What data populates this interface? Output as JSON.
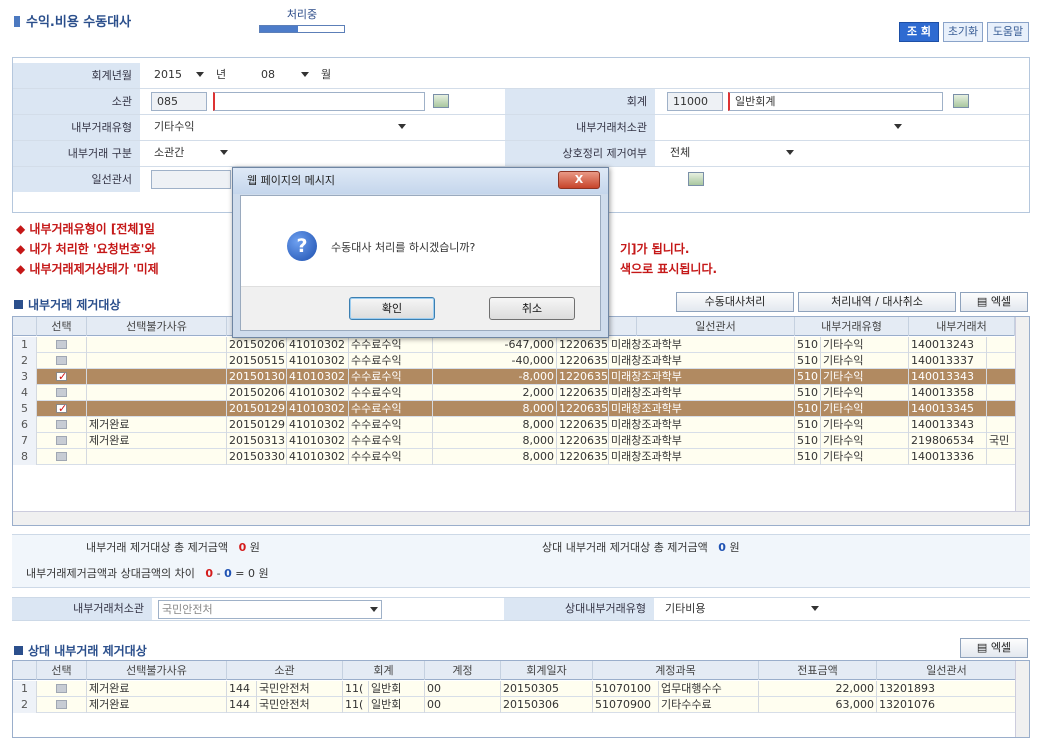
{
  "header": {
    "title": "수익.비용 수동대사",
    "processing": "처리중",
    "processing_progress": 0.45,
    "buttons": {
      "search": "조 회",
      "reset": "초기화",
      "help": "도움말"
    }
  },
  "form": {
    "account_year_label": "회계년월",
    "year": "2015",
    "year_unit": "년",
    "month": "08",
    "month_unit": "월",
    "office_label": "소관",
    "office_code": "085",
    "office_name": "",
    "accounting_label": "회계",
    "accounting_code": "11000",
    "accounting_name": "일반회계",
    "type_label": "내부거래유형",
    "type_value": "기타수익",
    "counter_office_label": "내부거래처소관",
    "counter_office_value": "",
    "category_label": "내부거래 구분",
    "category_value": "소관간",
    "cancel_label": "상호정리 제거여부",
    "cancel_value": "전체",
    "line_office_label": "일선관서"
  },
  "notes": [
    "◆ 내부거래유형이 [전체]일",
    "◆ 내가 처리한 '요청번호'와",
    "◆ 내부거래제거상태가 '미제"
  ],
  "notes_tail": [
    "",
    "기]가 됩니다.",
    "색으로 표시됩니다."
  ],
  "section1": {
    "title": "내부거래 제거대상",
    "btn_manual": "수동대사처리",
    "btn_history": "처리내역 / 대사취소",
    "btn_excel": "엑셀",
    "headers": [
      "선택",
      "선택불가사유",
      "",
      "",
      "",
      "",
      "일선관서",
      "내부거래유형",
      "내부거래처"
    ],
    "rows": [
      {
        "no": "1",
        "checked": false,
        "reason": "",
        "date": "20150206",
        "acct": "41010302",
        "item": "수수료수익",
        "amount": "-647,000",
        "office": "1220635",
        "office_name": "미래창조과학부",
        "type_code": "510",
        "type_name": "기타수익",
        "ref": "140013243",
        "extra": "",
        "selected": false
      },
      {
        "no": "2",
        "checked": false,
        "reason": "",
        "date": "20150515",
        "acct": "41010302",
        "item": "수수료수익",
        "amount": "-40,000",
        "office": "1220635",
        "office_name": "미래창조과학부",
        "type_code": "510",
        "type_name": "기타수익",
        "ref": "140013337",
        "extra": "",
        "selected": false
      },
      {
        "no": "3",
        "checked": true,
        "reason": "",
        "date": "20150130",
        "acct": "41010302",
        "item": "수수료수익",
        "amount": "-8,000",
        "office": "1220635",
        "office_name": "미래창조과학부",
        "type_code": "510",
        "type_name": "기타수익",
        "ref": "140013343",
        "extra": "",
        "selected": true
      },
      {
        "no": "4",
        "checked": false,
        "reason": "",
        "date": "20150206",
        "acct": "41010302",
        "item": "수수료수익",
        "amount": "2,000",
        "office": "1220635",
        "office_name": "미래창조과학부",
        "type_code": "510",
        "type_name": "기타수익",
        "ref": "140013358",
        "extra": "",
        "selected": false
      },
      {
        "no": "5",
        "checked": true,
        "reason": "",
        "date": "20150129",
        "acct": "41010302",
        "item": "수수료수익",
        "amount": "8,000",
        "office": "1220635",
        "office_name": "미래창조과학부",
        "type_code": "510",
        "type_name": "기타수익",
        "ref": "140013345",
        "extra": "",
        "selected": true
      },
      {
        "no": "6",
        "checked": false,
        "reason": "제거완료",
        "date": "20150129",
        "acct": "41010302",
        "item": "수수료수익",
        "amount": "8,000",
        "office": "1220635",
        "office_name": "미래창조과학부",
        "type_code": "510",
        "type_name": "기타수익",
        "ref": "140013343",
        "extra": "",
        "selected": false
      },
      {
        "no": "7",
        "checked": false,
        "reason": "제거완료",
        "date": "20150313",
        "acct": "41010302",
        "item": "수수료수익",
        "amount": "8,000",
        "office": "1220635",
        "office_name": "미래창조과학부",
        "type_code": "510",
        "type_name": "기타수익",
        "ref": "219806534",
        "extra": "국민",
        "selected": false
      },
      {
        "no": "8",
        "checked": false,
        "reason": "",
        "date": "20150330",
        "acct": "41010302",
        "item": "수수료수익",
        "amount": "8,000",
        "office": "1220635",
        "office_name": "미래창조과학부",
        "type_code": "510",
        "type_name": "기타수익",
        "ref": "140013336",
        "extra": "",
        "selected": false
      }
    ]
  },
  "summary": {
    "total_label": "내부거래 제거대상 총 제거금액",
    "total_value": "0",
    "total_unit": "원",
    "counter_total_label": "상대 내부거래 제거대상 총 제거금액",
    "counter_total_value": "0",
    "counter_total_unit": "원",
    "diff_label": "내부거래제거금액과 상대금액의 차이",
    "diff_a": "0",
    "diff_minus": "-",
    "diff_b": "0",
    "diff_eq": "=",
    "diff_result": "0",
    "diff_unit": "원"
  },
  "filter2": {
    "counter_office_label": "내부거래처소관",
    "counter_office_value": "국민안전처",
    "counter_type_label": "상대내부거래유형",
    "counter_type_value": "기타비용"
  },
  "section2": {
    "title": "상대 내부거래 제거대상",
    "btn_excel": "엑셀",
    "headers": [
      "선택",
      "선택불가사유",
      "소관",
      "회계",
      "계정",
      "회계일자",
      "계정과목",
      "전표금액",
      "일선관서"
    ],
    "rows": [
      {
        "no": "1",
        "reason": "제거완료",
        "code": "144",
        "office": "국민안전처",
        "acct": "11(",
        "acct_name": "일반회",
        "acct_code": "00",
        "date": "20150305",
        "subject_code": "51070100",
        "subject": "업무대행수수",
        "amount": "22,000",
        "line": "13201893"
      },
      {
        "no": "2",
        "reason": "제거완료",
        "code": "144",
        "office": "국민안전처",
        "acct": "11(",
        "acct_name": "일반회",
        "acct_code": "00",
        "date": "20150306",
        "subject_code": "51070900",
        "subject": "기타수수료",
        "amount": "63,000",
        "line": "13201076"
      }
    ]
  },
  "dialog": {
    "title": "웹 페이지의 메시지",
    "close": "X",
    "message": "수동대사 처리를 하시겠습니까?",
    "ok": "확인",
    "cancel": "취소"
  }
}
